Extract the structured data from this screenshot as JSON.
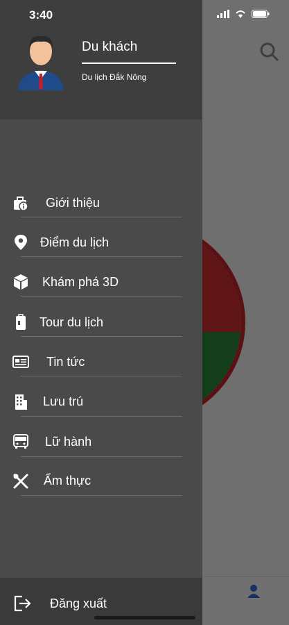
{
  "status_bar": {
    "time": "3:40"
  },
  "drawer": {
    "user": {
      "name": "Du khách",
      "subtitle": "Du lịch Đắk Nông"
    },
    "menu": [
      {
        "label": "Giới thiệu",
        "icon": "briefcase-info-icon"
      },
      {
        "label": "Điểm du lịch",
        "icon": "map-pin-icon"
      },
      {
        "label": "Khám phá 3D",
        "icon": "cube-icon"
      },
      {
        "label": "Tour du lịch",
        "icon": "suitcase-icon"
      },
      {
        "label": "Tin tức",
        "icon": "newspaper-icon"
      },
      {
        "label": "Lưu trú",
        "icon": "hotel-icon"
      },
      {
        "label": "Lữ hành",
        "icon": "bus-icon"
      },
      {
        "label": "Ẩm thực",
        "icon": "utensils-icon"
      }
    ],
    "logout": {
      "label": "Đăng xuất",
      "icon": "logout-icon"
    }
  },
  "colors": {
    "drawer_bg": "#4a4a4a",
    "drawer_header_bg": "#3e3e3e",
    "text": "#ffffff",
    "accent_blue": "#2f6fd6"
  }
}
